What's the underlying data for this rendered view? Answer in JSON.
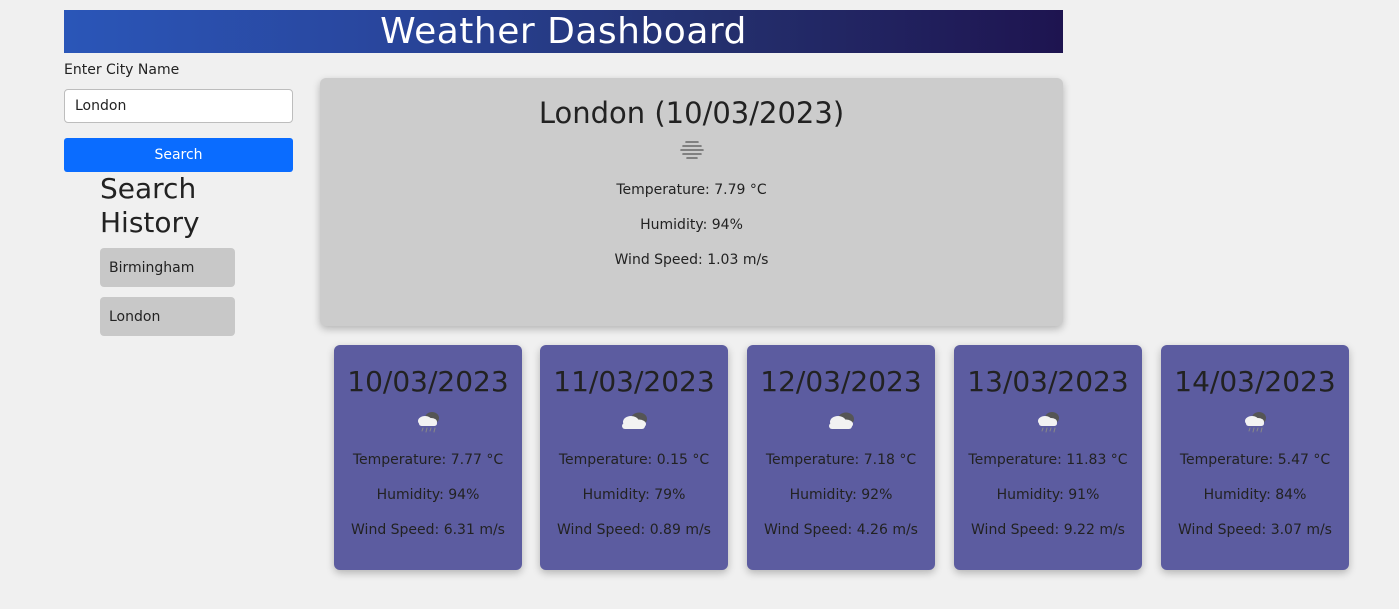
{
  "header": {
    "title": "Weather Dashboard"
  },
  "search": {
    "label": "Enter City Name",
    "value": "London",
    "button_label": "Search"
  },
  "history": {
    "title": "Search History",
    "items": [
      "Birmingham",
      "London"
    ]
  },
  "current": {
    "heading": "London (10/03/2023)",
    "icon": "mist-icon",
    "temperature": "Temperature: 7.79 °C",
    "humidity": "Humidity: 94%",
    "wind": "Wind Speed: 1.03 m/s"
  },
  "forecast": [
    {
      "date": "10/03/2023",
      "icon": "rain-cloud-icon",
      "temperature": "Temperature: 7.77 °C",
      "humidity": "Humidity: 94%",
      "wind": "Wind Speed: 6.31 m/s"
    },
    {
      "date": "11/03/2023",
      "icon": "cloudy-icon",
      "temperature": "Temperature: 0.15 °C",
      "humidity": "Humidity: 79%",
      "wind": "Wind Speed: 0.89 m/s"
    },
    {
      "date": "12/03/2023",
      "icon": "cloudy-icon",
      "temperature": "Temperature: 7.18 °C",
      "humidity": "Humidity: 92%",
      "wind": "Wind Speed: 4.26 m/s"
    },
    {
      "date": "13/03/2023",
      "icon": "rain-cloud-icon",
      "temperature": "Temperature: 11.83 °C",
      "humidity": "Humidity: 91%",
      "wind": "Wind Speed: 9.22 m/s"
    },
    {
      "date": "14/03/2023",
      "icon": "rain-cloud-icon",
      "temperature": "Temperature: 5.47 °C",
      "humidity": "Humidity: 84%",
      "wind": "Wind Speed: 3.07 m/s"
    }
  ],
  "colors": {
    "accent": "#0a6cff",
    "forecast_card": "#5c5ca0",
    "current_card": "#cccccc",
    "history_item": "#c8c8c8"
  }
}
